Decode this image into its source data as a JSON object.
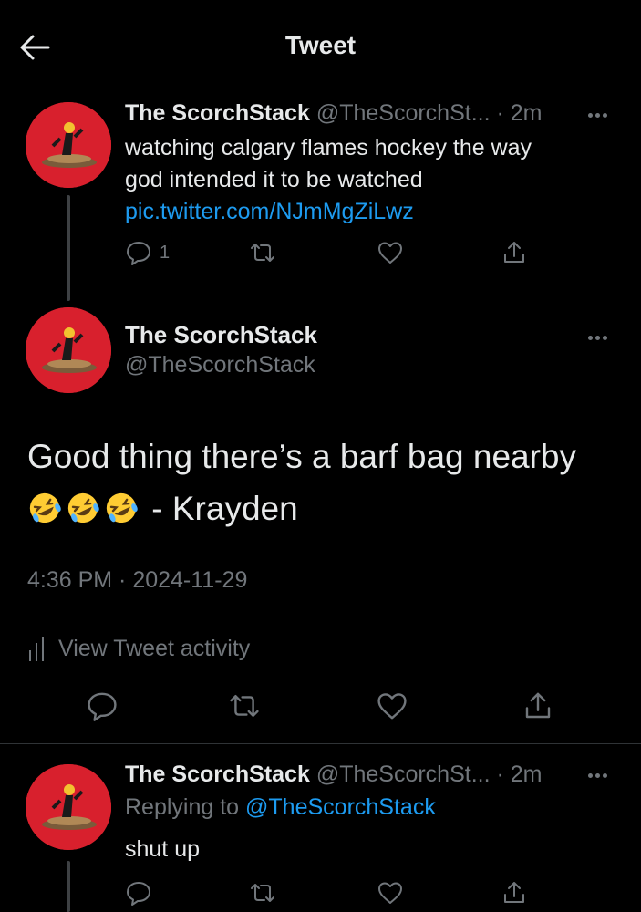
{
  "header": {
    "title": "Tweet"
  },
  "parent_tweet": {
    "name": "The ScorchStack",
    "handle": "@TheScorchSt...",
    "separator": "·",
    "time": "2m",
    "text_line1": "watching calgary flames hockey the way",
    "text_line2": "god intended it to be watched",
    "link": "pic.twitter.com/NJmMgZiLwz",
    "reply_count": "1"
  },
  "main_tweet": {
    "name": "The ScorchStack",
    "handle": "@TheScorchStack",
    "text_line1": "Good thing there’s a barf bag nearby",
    "text_suffix": " - Krayden",
    "emoji_count": 3,
    "timestamp": "4:36 PM · 2024-11-29",
    "activity_label": "View Tweet activity"
  },
  "reply_tweet": {
    "name": "The ScorchStack",
    "handle": "@TheScorchSt...",
    "separator": "·",
    "time": "2m",
    "replying_prefix": "Replying to ",
    "replying_handle": "@TheScorchStack",
    "text": "shut up"
  },
  "colors": {
    "background": "#000000",
    "text": "#e7e9ea",
    "muted": "#71767b",
    "link": "#1d9bf0",
    "avatar": "#d8202d"
  },
  "icons": [
    "back-arrow-icon",
    "more-icon",
    "reply-icon",
    "retweet-icon",
    "like-icon",
    "share-icon",
    "activity-chart-icon",
    "rofl-emoji-icon"
  ]
}
